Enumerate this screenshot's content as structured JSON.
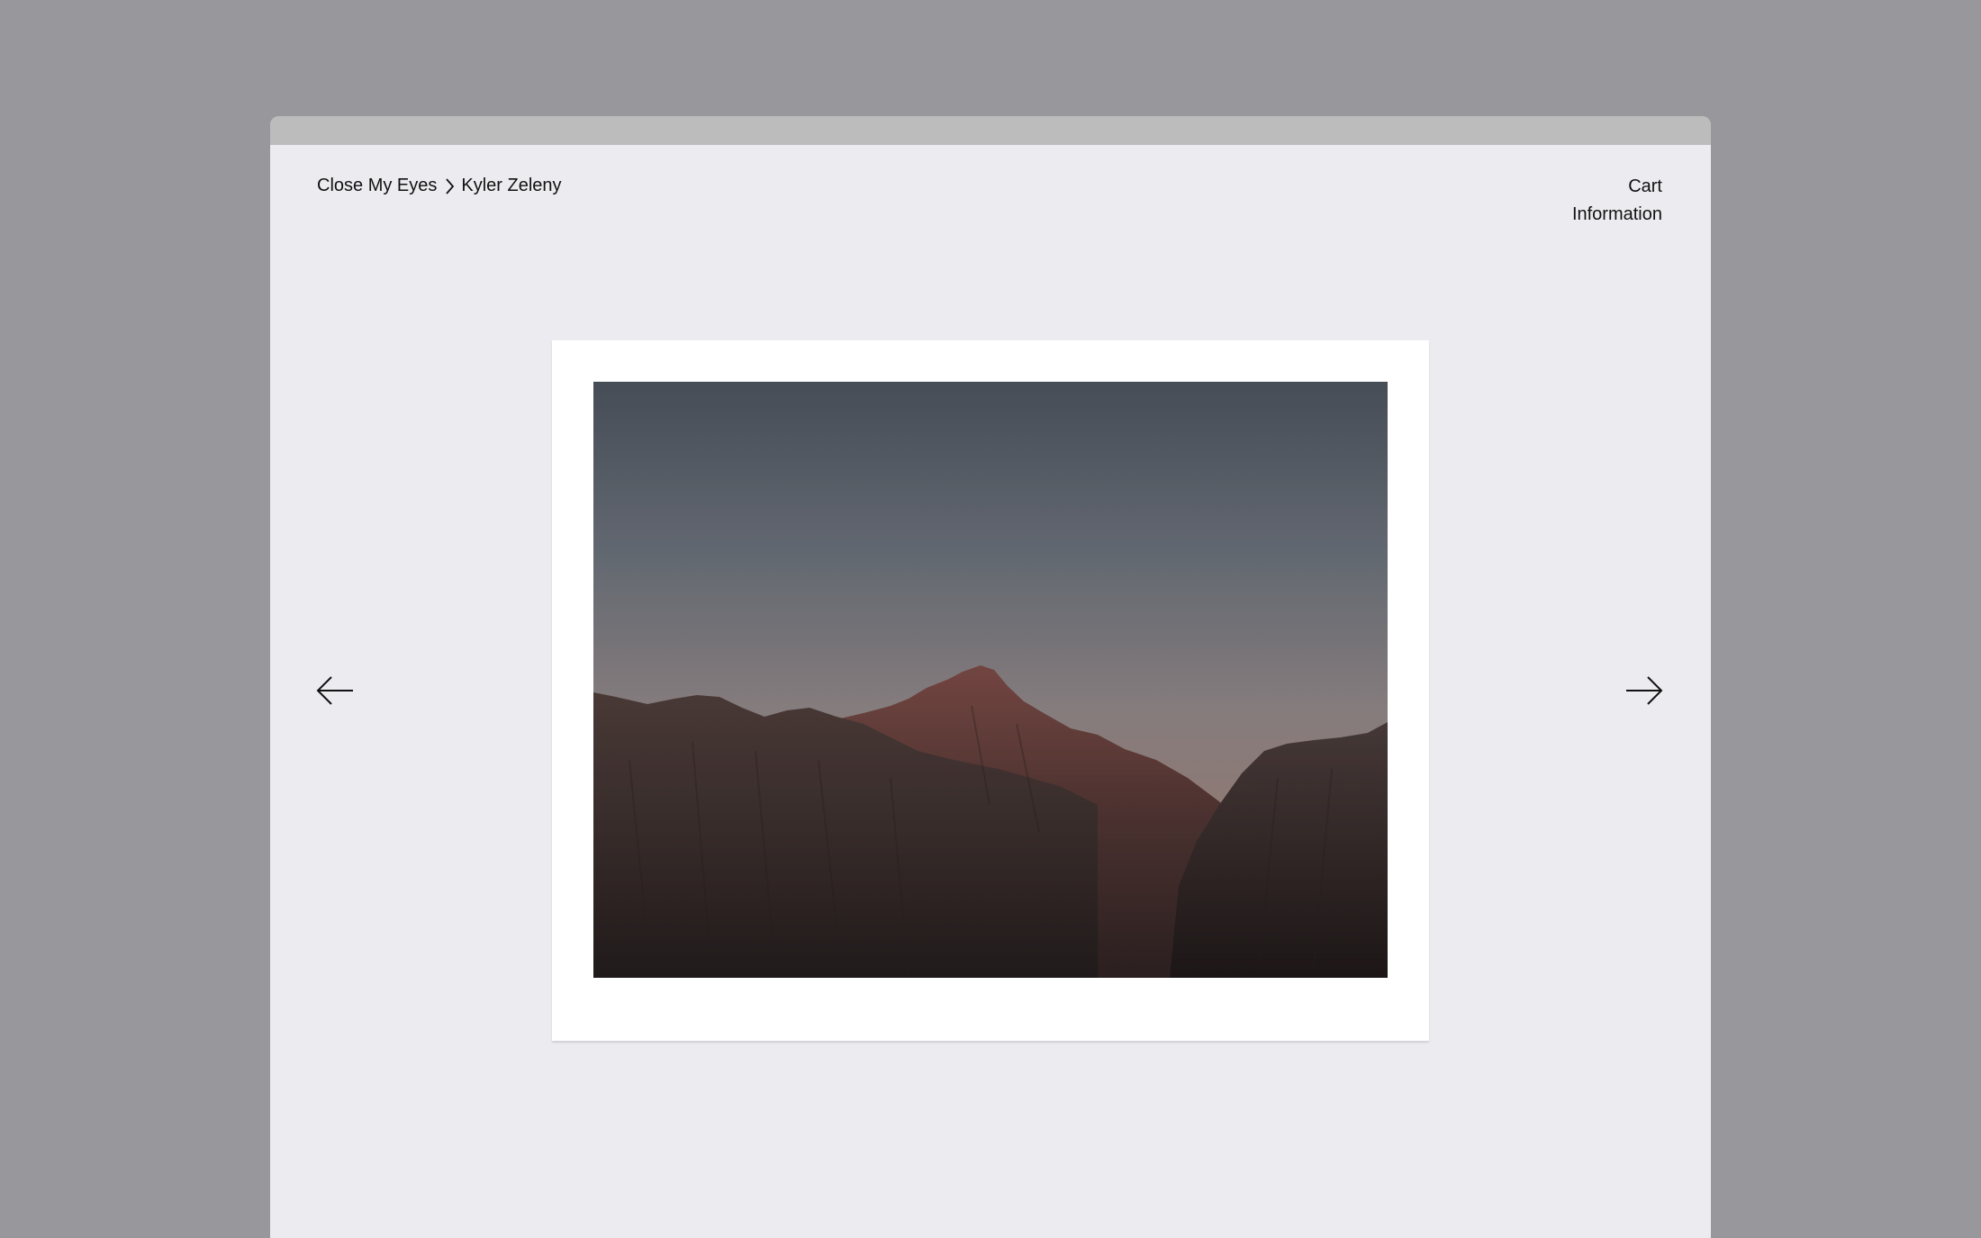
{
  "breadcrumb": {
    "parent_label": "Close My Eyes",
    "current_label": "Kyler Zeleny",
    "separator_icon": "chevron-right-icon"
  },
  "nav": {
    "cart_label": "Cart",
    "information_label": "Information"
  },
  "gallery": {
    "prev_icon": "arrow-left-icon",
    "next_icon": "arrow-right-icon",
    "photo_subject": "mountain-peak-at-dusk"
  },
  "colors": {
    "page_background": "#ecebf0",
    "outer_background": "#98979c",
    "title_bar": "#bcbcbc",
    "text": "#111111",
    "frame": "#ffffff"
  }
}
